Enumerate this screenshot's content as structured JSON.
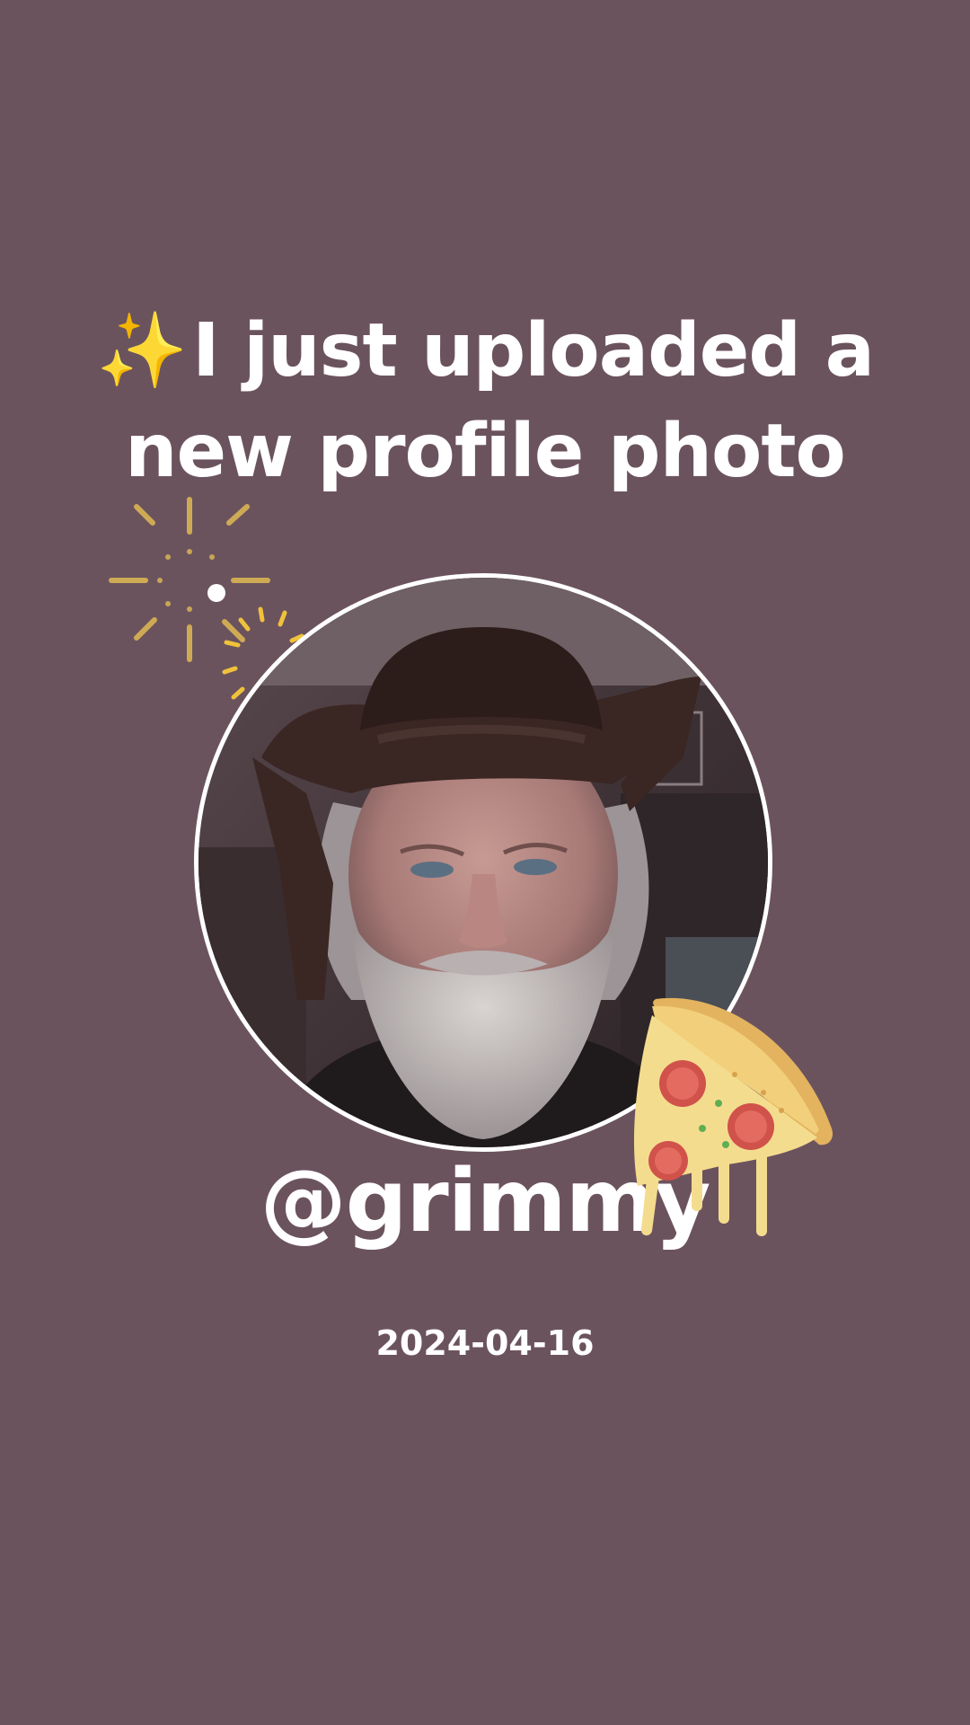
{
  "post": {
    "headline_line1": "I just uploaded a",
    "headline_line2": "new profile photo",
    "sparkle_glyph": "✨",
    "username": "@grimmy",
    "date": "2024-04-16"
  },
  "decorations": {
    "sparkle_icon": "sparkles-emoji",
    "burst_icon": "firework-burst",
    "pizza_icon": "pizza-slice-emoji",
    "photo_subject": "bearded man wearing a dark cowboy hat"
  },
  "colors": {
    "background": "#6b535e",
    "text": "#ffffff",
    "accent": "#e9c04d"
  }
}
